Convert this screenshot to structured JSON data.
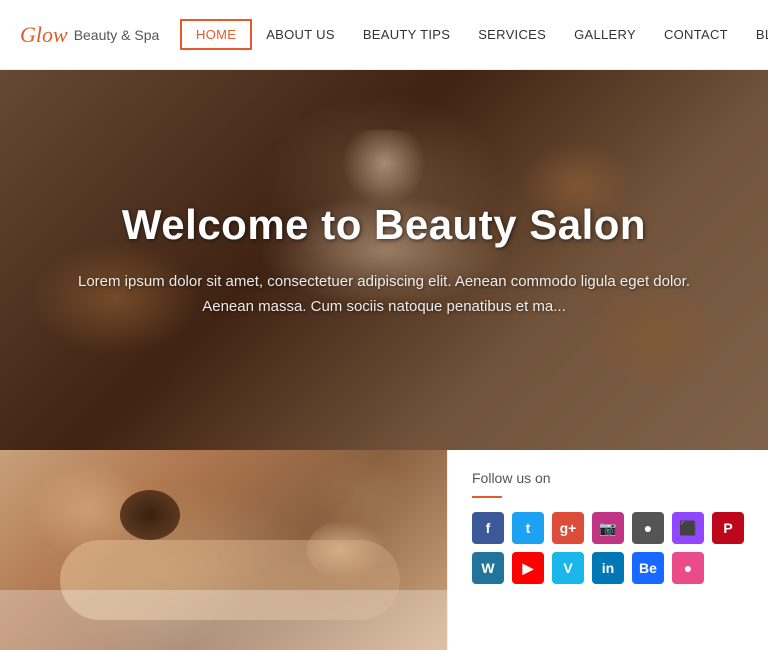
{
  "header": {
    "logo_glow": "Glow",
    "logo_subtitle": "Beauty & Spa",
    "nav": [
      {
        "label": "HOME",
        "active": true
      },
      {
        "label": "ABOUT US",
        "active": false
      },
      {
        "label": "BEAUTY TIPS",
        "active": false
      },
      {
        "label": "SERVICES",
        "active": false
      },
      {
        "label": "GALLERY",
        "active": false
      },
      {
        "label": "CONTACT",
        "active": false
      },
      {
        "label": "BLOG",
        "active": false
      }
    ]
  },
  "hero": {
    "title": "Welcome to Beauty Salon",
    "description": "Lorem ipsum dolor sit amet, consectetuer adipiscing elit. Aenean commodo ligula eget dolor.\nAenean massa. Cum sociis natoque penatibus et ma..."
  },
  "below": {
    "follow_us": "Follow us on",
    "social_rows": [
      [
        {
          "label": "f",
          "cls": "sb-facebook",
          "name": "facebook"
        },
        {
          "label": "t",
          "cls": "sb-twitter",
          "name": "twitter"
        },
        {
          "label": "g+",
          "cls": "sb-google",
          "name": "google-plus"
        },
        {
          "label": "📷",
          "cls": "sb-instagram",
          "name": "instagram"
        },
        {
          "label": "●",
          "cls": "sb-circle",
          "name": "circle"
        },
        {
          "label": "⬛",
          "cls": "sb-twitch",
          "name": "twitch"
        },
        {
          "label": "P",
          "cls": "sb-pinterest",
          "name": "pinterest"
        }
      ],
      [
        {
          "label": "W",
          "cls": "sb-wordpress",
          "name": "wordpress"
        },
        {
          "label": "▶",
          "cls": "sb-youtube",
          "name": "youtube"
        },
        {
          "label": "V",
          "cls": "sb-vimeo",
          "name": "vimeo"
        },
        {
          "label": "in",
          "cls": "sb-linkedin",
          "name": "linkedin"
        },
        {
          "label": "Be",
          "cls": "sb-behance",
          "name": "behance"
        },
        {
          "label": "●",
          "cls": "sb-dribbble",
          "name": "dribbble"
        }
      ]
    ]
  }
}
